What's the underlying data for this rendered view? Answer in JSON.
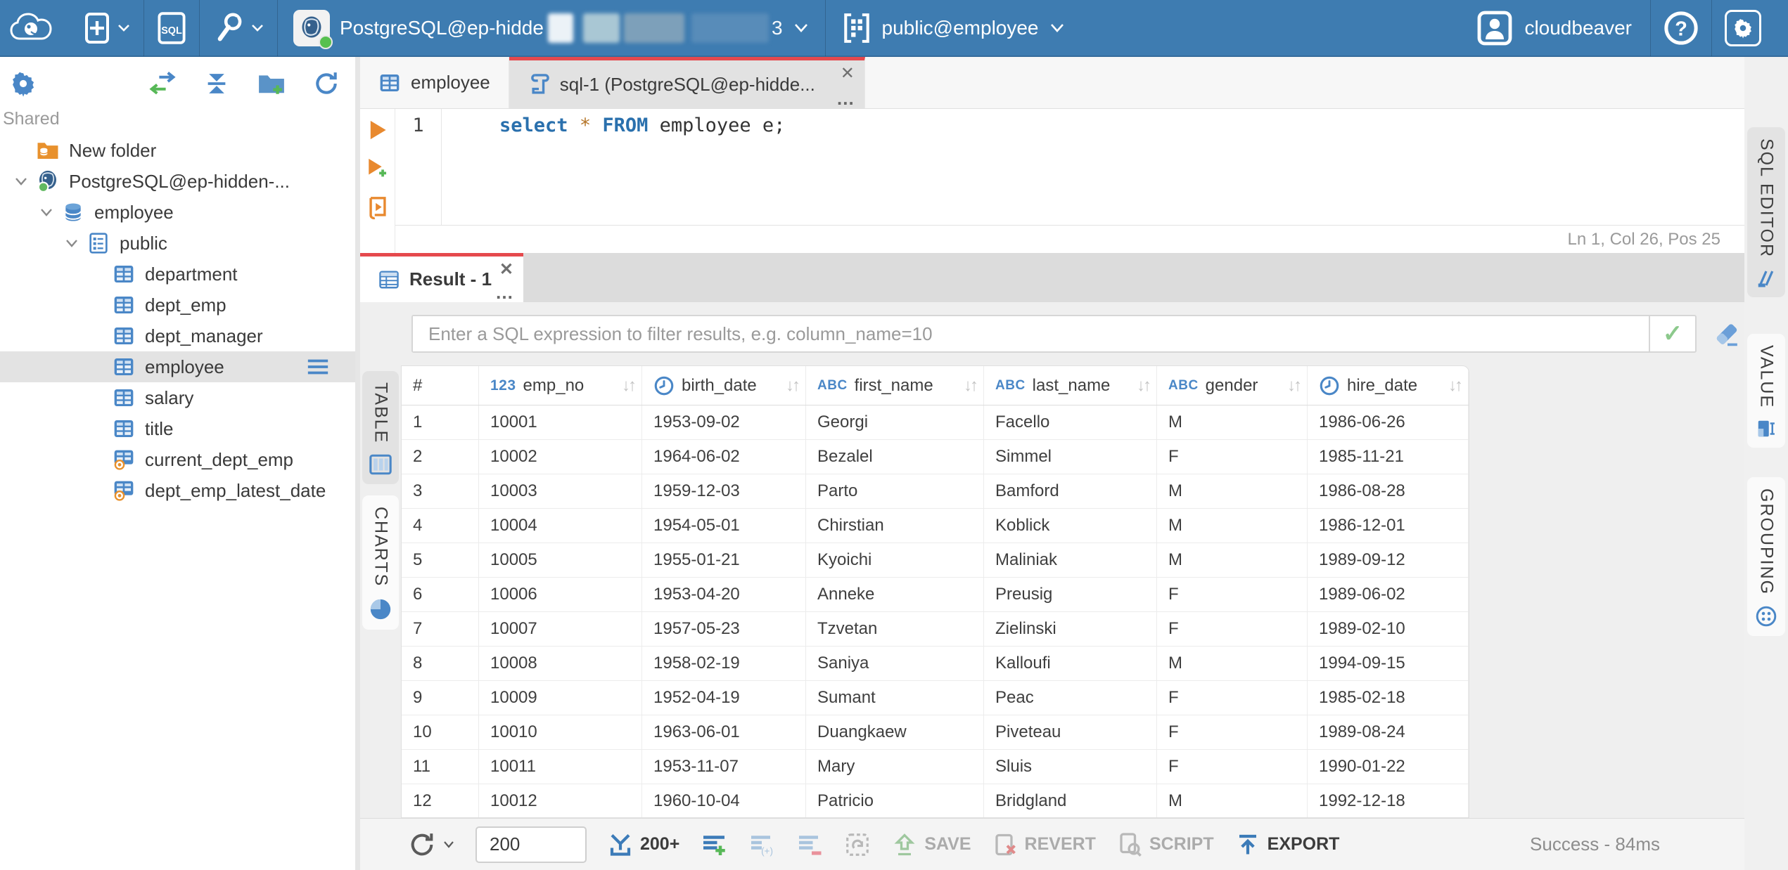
{
  "topbar": {
    "connection": {
      "label": "PostgreSQL@ep-hidde",
      "masked": true,
      "suffix": "3"
    },
    "schema": {
      "label": "public@employee"
    },
    "user": {
      "name": "cloudbeaver"
    }
  },
  "sidebar": {
    "section_label": "Shared",
    "items": [
      {
        "label": "New folder",
        "icon": "folder",
        "depth": 0,
        "chevron": false,
        "selected": false
      },
      {
        "label": "PostgreSQL@ep-hidden-...",
        "icon": "postgres",
        "depth": 0,
        "chevron": true,
        "selected": false
      },
      {
        "label": "employee",
        "icon": "database",
        "depth": 1,
        "chevron": true,
        "selected": false
      },
      {
        "label": "public",
        "icon": "schema",
        "depth": 2,
        "chevron": true,
        "selected": false
      },
      {
        "label": "department",
        "icon": "table",
        "depth": 3,
        "chevron": false,
        "selected": false
      },
      {
        "label": "dept_emp",
        "icon": "table",
        "depth": 3,
        "chevron": false,
        "selected": false
      },
      {
        "label": "dept_manager",
        "icon": "table",
        "depth": 3,
        "chevron": false,
        "selected": false
      },
      {
        "label": "employee",
        "icon": "table",
        "depth": 3,
        "chevron": false,
        "selected": true
      },
      {
        "label": "salary",
        "icon": "table",
        "depth": 3,
        "chevron": false,
        "selected": false
      },
      {
        "label": "title",
        "icon": "table",
        "depth": 3,
        "chevron": false,
        "selected": false
      },
      {
        "label": "current_dept_emp",
        "icon": "view",
        "depth": 3,
        "chevron": false,
        "selected": false
      },
      {
        "label": "dept_emp_latest_date",
        "icon": "view",
        "depth": 3,
        "chevron": false,
        "selected": false
      }
    ]
  },
  "editor": {
    "tabs": [
      {
        "label": "employee",
        "active": false
      },
      {
        "label": "sql-1 (PostgreSQL@ep-hidde...",
        "active": true
      }
    ],
    "line_number": "1",
    "code": [
      {
        "text": "select",
        "type": "keyword"
      },
      {
        "text": " ",
        "type": "plain"
      },
      {
        "text": "*",
        "type": "star"
      },
      {
        "text": " ",
        "type": "plain"
      },
      {
        "text": "FROM",
        "type": "keyword"
      },
      {
        "text": " employee e;",
        "type": "plain"
      }
    ],
    "status": "Ln 1, Col 26, Pos 25",
    "side_tab": "SQL EDITOR"
  },
  "result": {
    "tab_label": "Result - 1",
    "filter_placeholder": "Enter a SQL expression to filter results, e.g. column_name=10",
    "left_tabs": {
      "table": "TABLE",
      "charts": "CHARTS"
    },
    "right_tabs": {
      "value": "VALUE",
      "grouping": "GROUPING"
    },
    "grid": {
      "row_header": "#",
      "type_icons": {
        "number": "123",
        "string": "ABC"
      },
      "columns": [
        {
          "name": "emp_no",
          "type": "number"
        },
        {
          "name": "birth_date",
          "type": "date"
        },
        {
          "name": "first_name",
          "type": "string"
        },
        {
          "name": "last_name",
          "type": "string"
        },
        {
          "name": "gender",
          "type": "string"
        },
        {
          "name": "hire_date",
          "type": "date"
        }
      ],
      "rows": [
        [
          "1",
          "10001",
          "1953-09-02",
          "Georgi",
          "Facello",
          "M",
          "1986-06-26"
        ],
        [
          "2",
          "10002",
          "1964-06-02",
          "Bezalel",
          "Simmel",
          "F",
          "1985-11-21"
        ],
        [
          "3",
          "10003",
          "1959-12-03",
          "Parto",
          "Bamford",
          "M",
          "1986-08-28"
        ],
        [
          "4",
          "10004",
          "1954-05-01",
          "Chirstian",
          "Koblick",
          "M",
          "1986-12-01"
        ],
        [
          "5",
          "10005",
          "1955-01-21",
          "Kyoichi",
          "Maliniak",
          "M",
          "1989-09-12"
        ],
        [
          "6",
          "10006",
          "1953-04-20",
          "Anneke",
          "Preusig",
          "F",
          "1989-06-02"
        ],
        [
          "7",
          "10007",
          "1957-05-23",
          "Tzvetan",
          "Zielinski",
          "F",
          "1989-02-10"
        ],
        [
          "8",
          "10008",
          "1958-02-19",
          "Saniya",
          "Kalloufi",
          "M",
          "1994-09-15"
        ],
        [
          "9",
          "10009",
          "1952-04-19",
          "Sumant",
          "Peac",
          "F",
          "1985-02-18"
        ],
        [
          "10",
          "10010",
          "1963-06-01",
          "Duangkaew",
          "Piveteau",
          "F",
          "1989-08-24"
        ],
        [
          "11",
          "10011",
          "1953-11-07",
          "Mary",
          "Sluis",
          "F",
          "1990-01-22"
        ],
        [
          "12",
          "10012",
          "1960-10-04",
          "Patricio",
          "Bridgland",
          "M",
          "1992-12-18"
        ]
      ]
    },
    "toolbar": {
      "row_limit": "200",
      "fetch_more_label": "200+",
      "save_label": "SAVE",
      "revert_label": "REVERT",
      "script_label": "SCRIPT",
      "export_label": "EXPORT"
    },
    "status": "Success - 84ms"
  },
  "colors": {
    "topbar": "#3e7cb1",
    "accent": "#4a87c7",
    "active_tab_accent": "#e5494d",
    "keyword": "#2a70ad",
    "star_operator": "#b5762a",
    "success_text": "#8d8d8d"
  }
}
